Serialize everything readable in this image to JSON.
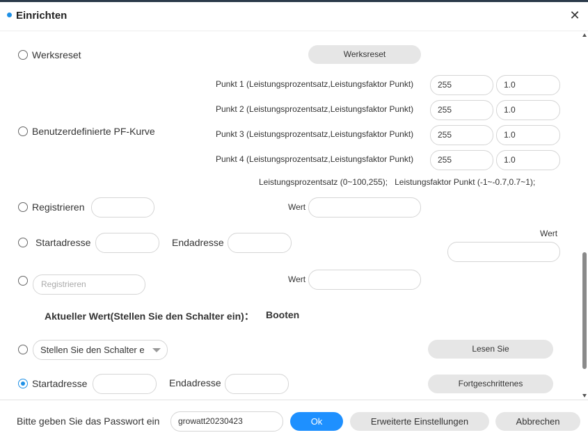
{
  "dialog": {
    "title": "Einrichten"
  },
  "factory_reset": {
    "label": "Werksreset",
    "button": "Werksreset"
  },
  "pf_curve": {
    "label": "Benutzerdefinierte PF-Kurve",
    "points": [
      {
        "label": "Punkt 1 (Leistungsprozentsatz,Leistungsfaktor Punkt)",
        "percent": "255",
        "factor": "1.0"
      },
      {
        "label": "Punkt 2 (Leistungsprozentsatz,Leistungsfaktor Punkt)",
        "percent": "255",
        "factor": "1.0"
      },
      {
        "label": "Punkt 3 (Leistungsprozentsatz,Leistungsfaktor Punkt)",
        "percent": "255",
        "factor": "1.0"
      },
      {
        "label": "Punkt 4 (Leistungsprozentsatz,Leistungsfaktor Punkt)",
        "percent": "255",
        "factor": "1.0"
      }
    ],
    "hint": "Leistungsprozentsatz (0~100,255);   Leistungsfaktor Punkt (-1~-0.7,0.7~1);"
  },
  "register_row": {
    "label": "Registrieren",
    "value_label": "Wert"
  },
  "range_row": {
    "start_label": "Startadresse",
    "end_label": "Endadresse",
    "value_label": "Wert"
  },
  "register_row2": {
    "placeholder": "Registrieren",
    "value_label": "Wert"
  },
  "current_value": {
    "label": "Aktueller Wert(Stellen Sie den Schalter ein)：",
    "value": "Booten"
  },
  "switch_row": {
    "select_value": "Stellen Sie den Schalter e",
    "button": "Lesen Sie"
  },
  "range_row2": {
    "start_label": "Startadresse",
    "end_label": "Endadresse",
    "button": "Fortgeschrittenes"
  },
  "footer": {
    "password_label": "Bitte geben Sie das Passwort ein",
    "password_value": "growatt20230423",
    "ok": "Ok",
    "advanced": "Erweiterte Einstellungen",
    "cancel": "Abbrechen"
  }
}
